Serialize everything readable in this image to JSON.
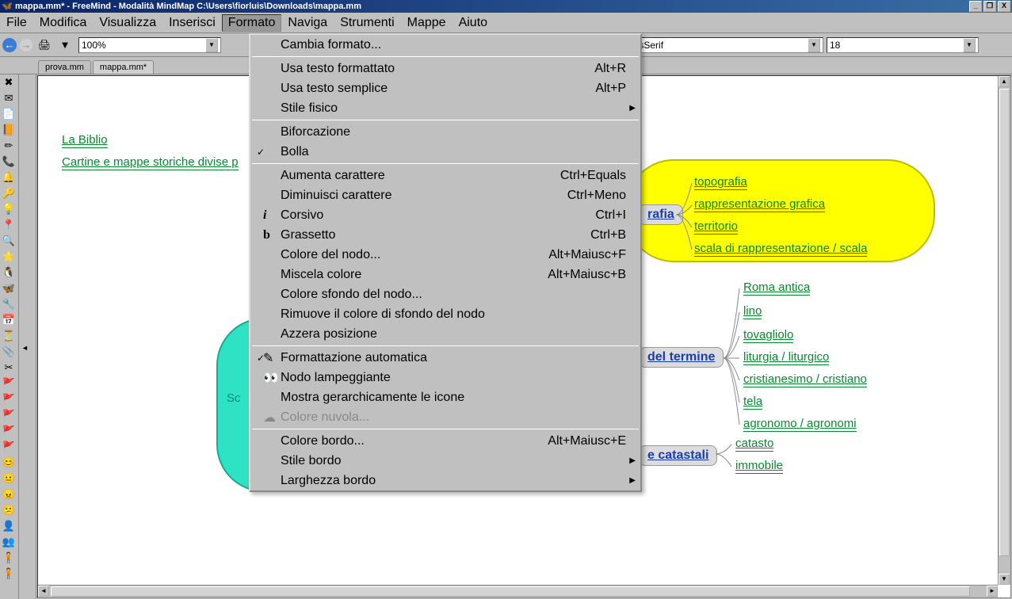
{
  "titlebar": {
    "text": "mappa.mm* - FreeMind - Modalità MindMap C:\\Users\\fiorluis\\Downloads\\mappa.mm"
  },
  "menubar": {
    "items": [
      "File",
      "Modifica",
      "Visualizza",
      "Inserisci",
      "Formato",
      "Naviga",
      "Strumenti",
      "Mappe",
      "Aiuto"
    ],
    "active_index": 4
  },
  "toolbar": {
    "zoom": "100%",
    "font_family": "SansSerif",
    "font_size": "18"
  },
  "tabs": {
    "items": [
      "prova.mm",
      "mappa.mm*"
    ],
    "active_index": 1
  },
  "dropdown": {
    "items": [
      {
        "label": "Cambia formato...",
        "shortcut": "",
        "type": "item"
      },
      {
        "type": "sep"
      },
      {
        "label": "Usa testo formattato",
        "shortcut": "Alt+R",
        "type": "item"
      },
      {
        "label": "Usa testo semplice",
        "shortcut": "Alt+P",
        "type": "item"
      },
      {
        "label": "Stile fisico",
        "shortcut": "",
        "type": "submenu"
      },
      {
        "type": "sep"
      },
      {
        "label": "Biforcazione",
        "shortcut": "",
        "type": "item"
      },
      {
        "label": "Bolla",
        "shortcut": "",
        "type": "item",
        "checked": true
      },
      {
        "type": "sep"
      },
      {
        "label": "Aumenta carattere",
        "shortcut": "Ctrl+Equals",
        "type": "item"
      },
      {
        "label": "Diminuisci carattere",
        "shortcut": "Ctrl+Meno",
        "type": "item"
      },
      {
        "label": "Corsivo",
        "shortcut": "Ctrl+I",
        "type": "item",
        "icon": "i"
      },
      {
        "label": "Grassetto",
        "shortcut": "Ctrl+B",
        "type": "item",
        "icon": "b"
      },
      {
        "label": "Colore del nodo...",
        "shortcut": "Alt+Maiusc+F",
        "type": "item"
      },
      {
        "label": "Miscela colore",
        "shortcut": "Alt+Maiusc+B",
        "type": "item"
      },
      {
        "label": "Colore sfondo del nodo...",
        "shortcut": "",
        "type": "item"
      },
      {
        "label": "Rimuove il colore di sfondo del nodo",
        "shortcut": "",
        "type": "item"
      },
      {
        "label": "Azzera posizione",
        "shortcut": "",
        "type": "item"
      },
      {
        "type": "sep"
      },
      {
        "label": "Formattazione automatica",
        "shortcut": "",
        "type": "item",
        "checked": true,
        "icon": "✎"
      },
      {
        "label": "Nodo lampeggiante",
        "shortcut": "",
        "type": "item",
        "icon": "👀"
      },
      {
        "label": "Mostra gerarchicamente le icone",
        "shortcut": "",
        "type": "item"
      },
      {
        "label": "Colore nuvola...",
        "shortcut": "",
        "type": "item",
        "disabled": true,
        "icon": "☁"
      },
      {
        "type": "sep"
      },
      {
        "label": "Colore bordo...",
        "shortcut": "Alt+Maiusc+E",
        "type": "item"
      },
      {
        "label": "Stile bordo",
        "shortcut": "",
        "type": "submenu"
      },
      {
        "label": "Larghezza bordo",
        "shortcut": "",
        "type": "submenu"
      }
    ]
  },
  "mindmap": {
    "left_links": [
      "La Biblio",
      "Cartine e mappe storiche divise p"
    ],
    "teal_label": "Sc",
    "box_cartografia": "rafia",
    "box_termine": "del termine",
    "box_catastali": "e catastali",
    "cartografia_children": [
      "topografia",
      "rappresentazione grafica",
      "territorio",
      "scala di rappresentazione / scala"
    ],
    "termine_children": [
      "Roma antica",
      "lino",
      "tovagliolo",
      "liturgia / liturgico",
      "cristianesimo / cristiano",
      "tela",
      "agronomo / agronomi"
    ],
    "catastali_children": [
      "catasto",
      "immobile"
    ]
  }
}
